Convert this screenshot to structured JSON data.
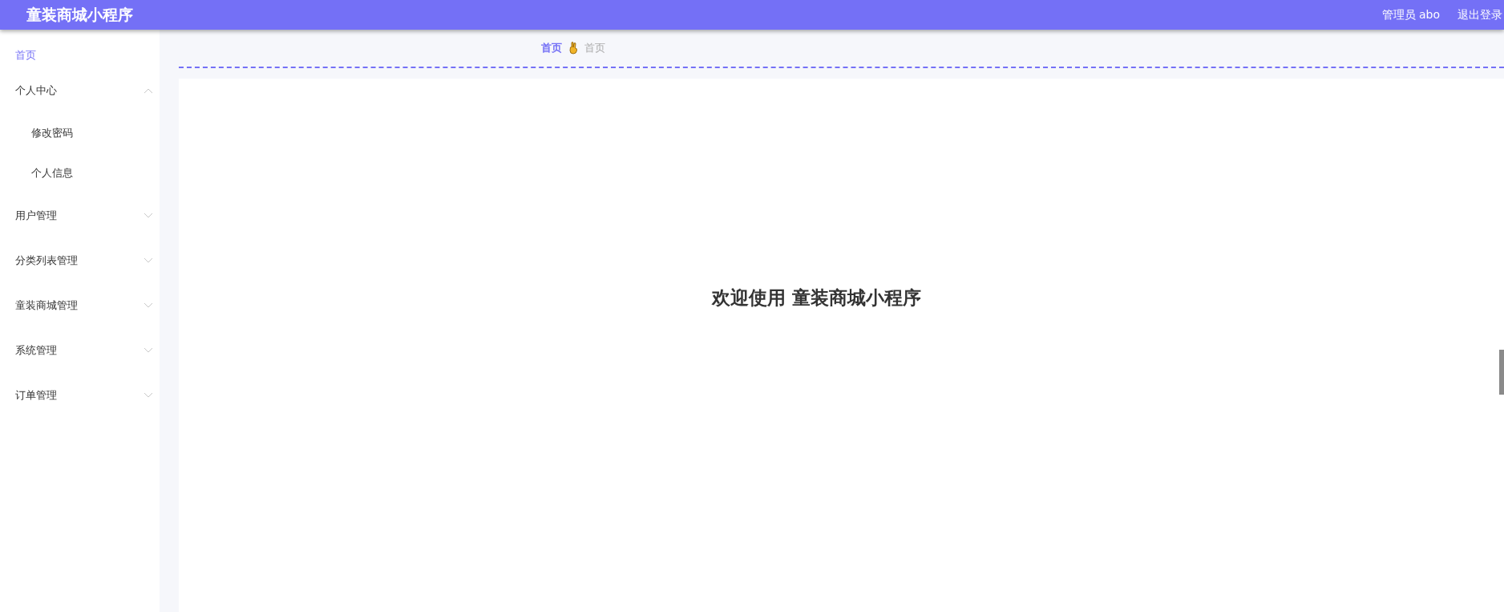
{
  "header": {
    "title": "童装商城小程序",
    "user": "管理员 abo",
    "logout": "退出登录"
  },
  "sidebar": {
    "items": [
      {
        "label": "首页",
        "selected": true,
        "kind": "link"
      },
      {
        "label": "个人中心",
        "selected": false,
        "kind": "group",
        "expanded": true,
        "children": [
          {
            "label": "修改密码",
            "selected": false
          },
          {
            "label": "个人信息",
            "selected": false
          }
        ]
      },
      {
        "label": "用户管理",
        "selected": false,
        "kind": "group",
        "expanded": false
      },
      {
        "label": "分类列表管理",
        "selected": false,
        "kind": "group",
        "expanded": false
      },
      {
        "label": "童装商城管理",
        "selected": false,
        "kind": "group",
        "expanded": false
      },
      {
        "label": "系统管理",
        "selected": false,
        "kind": "group",
        "expanded": false
      },
      {
        "label": "订单管理",
        "selected": false,
        "kind": "group",
        "expanded": false
      }
    ]
  },
  "breadcrumb": [
    {
      "label": "首页",
      "selected": true
    },
    {
      "label": "首页",
      "selected": false
    }
  ],
  "welcome": "欢迎使用 童装商城小程序"
}
